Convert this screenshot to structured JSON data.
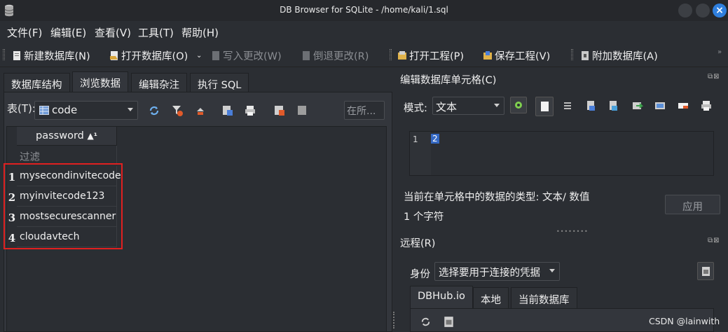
{
  "window": {
    "title": "DB Browser for SQLite - /home/kali/1.sql",
    "close_glyph": "×"
  },
  "menu": [
    "文件(F)",
    "编辑(E)",
    "查看(V)",
    "工具(T)",
    "帮助(H)"
  ],
  "toolbar": {
    "new_db": "新建数据库(N)",
    "open_db": "打开数据库(O)",
    "write_changes": "写入更改(W)",
    "revert_changes": "倒退更改(R)",
    "open_project": "打开工程(P)",
    "save_project": "保存工程(V)",
    "attach_db": "附加数据库(A)"
  },
  "tabs": [
    "数据库结构",
    "浏览数据",
    "编辑杂注",
    "执行 SQL"
  ],
  "browse": {
    "table_label": "表(T):",
    "table_name": "code",
    "search_placeholder": "在所...",
    "column_header": "password",
    "sort_indicator": "▲¹",
    "filter_placeholder": "过滤",
    "rows": [
      {
        "num": "1",
        "value": "mysecondinvitecode"
      },
      {
        "num": "2",
        "value": "myinvitecode123"
      },
      {
        "num": "3",
        "value": "mostsecurescanner"
      },
      {
        "num": "4",
        "value": "cloudavtech"
      }
    ]
  },
  "edit_cell": {
    "title": "编辑数据库单元格(C)",
    "mode_label": "模式:",
    "mode_value": "文本",
    "line_number": "1",
    "cell_value": "2",
    "data_type": "当前在单元格中的数据的类型: 文本/ 数值",
    "char_count": "1 个字符",
    "apply": "应用"
  },
  "remote": {
    "title": "远程(R)",
    "identity_label": "身份",
    "identity_value": "选择要用于连接的凭据",
    "tabs": [
      "DBHub.io",
      "本地",
      "当前数据库"
    ]
  },
  "watermark": "CSDN @lainwith",
  "colors": {
    "accent": "#2f7fde",
    "highlight_box": "#e02020",
    "selection": "#3569c4"
  }
}
